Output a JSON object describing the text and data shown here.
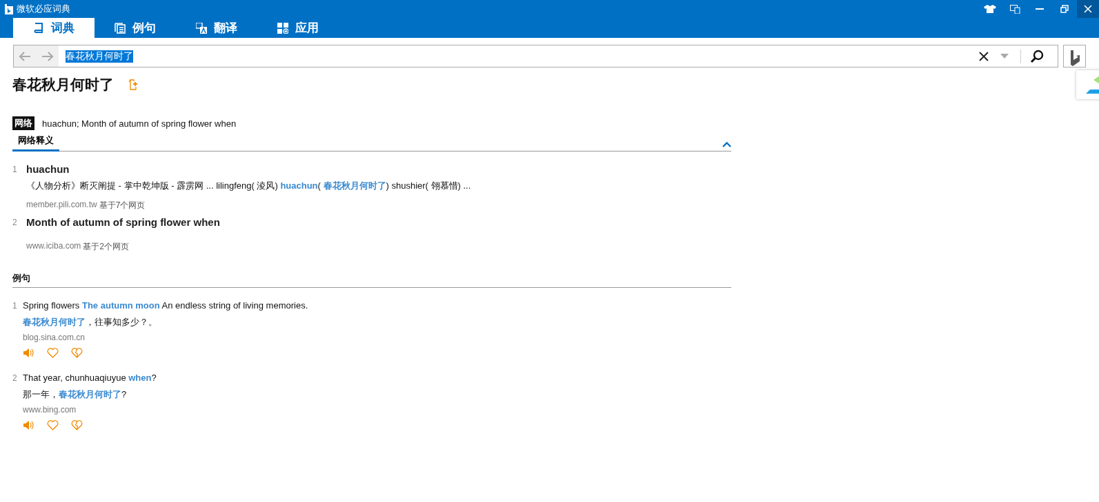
{
  "window": {
    "title": "微软必应词典"
  },
  "tabs": [
    {
      "label": "词典",
      "selected": true
    },
    {
      "label": "例句",
      "selected": false
    },
    {
      "label": "翻译",
      "selected": false
    },
    {
      "label": "应用",
      "selected": false
    }
  ],
  "search": {
    "value": "春花秋月何时了",
    "text_selected": true
  },
  "headword": "春花秋月何时了",
  "summary": {
    "tag": "网络",
    "text": "huachun; Month of autumn of spring flower when"
  },
  "web_definitions": {
    "tab": {
      "label": "网络释义",
      "selected": true
    },
    "expanded": true,
    "items": [
      {
        "number": "1",
        "term": "huachun",
        "snippet": [
          {
            "text": "《人物分析》断灭阐提 - 掌中乾坤版 - 霹雳网 ... lilingfeng( 淩风) ",
            "highlight": false
          },
          {
            "text": "huachun",
            "highlight": true
          },
          {
            "text": "( ",
            "highlight": false
          },
          {
            "text": "春花秋月何时了",
            "highlight": true
          },
          {
            "text": ") shushier( 翎慕惜) ...",
            "highlight": false
          }
        ],
        "source": "member.pili.com.tw",
        "count": "基于7个网页"
      },
      {
        "number": "2",
        "term": "Month of autumn of spring flower when",
        "source": "www.iciba.com",
        "count": "基于2个网页"
      }
    ]
  },
  "examples": {
    "heading": "例句",
    "items": [
      {
        "number": "1",
        "english": [
          {
            "text": "Spring flowers ",
            "highlight": false
          },
          {
            "text": "The autumn moon",
            "highlight": true
          },
          {
            "text": " An endless string of living memories.",
            "highlight": false
          }
        ],
        "chinese": [
          {
            "text": "春花秋月何时了",
            "highlight": true
          },
          {
            "text": "，往事知多少？。",
            "highlight": false
          }
        ],
        "source": "blog.sina.com.cn"
      },
      {
        "number": "2",
        "english": [
          {
            "text": "That year, chunhuaqiuyue ",
            "highlight": false
          },
          {
            "text": "when",
            "highlight": true
          },
          {
            "text": "?",
            "highlight": false
          }
        ],
        "chinese": [
          {
            "text": "那一年，",
            "highlight": false
          },
          {
            "text": "春花秋月何时了",
            "highlight": true
          },
          {
            "text": "?",
            "highlight": false
          }
        ],
        "source": "www.bing.com"
      }
    ]
  }
}
